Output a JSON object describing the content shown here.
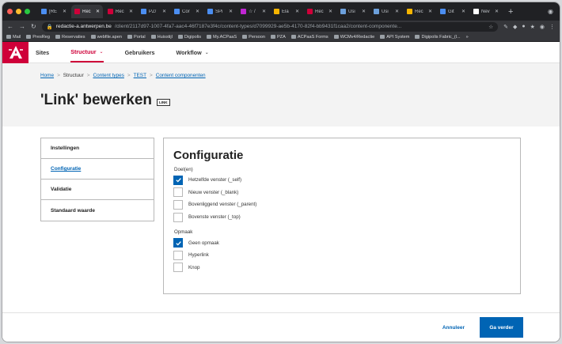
{
  "browser": {
    "tabs": [
      {
        "label": "[RE",
        "color": "#4b8ef1"
      },
      {
        "label": "Rec",
        "color": "#cf0039",
        "active": true
      },
      {
        "label": "Rec",
        "color": "#cf0039"
      },
      {
        "label": "PZ/",
        "color": "#4b8ef1"
      },
      {
        "label": "Cor",
        "color": "#4b8ef1"
      },
      {
        "label": "SPi",
        "color": "#4b8ef1"
      },
      {
        "label": "☆ /",
        "color": "#c026d3"
      },
      {
        "label": "Ela",
        "color": "#f6b500"
      },
      {
        "label": "Rec",
        "color": "#cf0039"
      },
      {
        "label": "Usi",
        "color": "#6ca0dc"
      },
      {
        "label": "Usi",
        "color": "#6ca0dc"
      },
      {
        "label": "Rec",
        "color": "#f6b500"
      },
      {
        "label": "Git",
        "color": "#4b8ef1"
      },
      {
        "label": "Nev",
        "color": "#ffffff"
      }
    ],
    "new_tab": "+",
    "url_host": "redactie-a.antwerpen.be",
    "url_path": "/client/2117d97-1007-4fa7-aac4-46f7187e3f4c/content-types/d7099929-ae5b-4170-82f4-bb9431f1caa2/content-componente...",
    "bookmarks": [
      "Mail",
      "PresReg",
      "Reservaties",
      "webfile.apen",
      "Portal",
      "Huisstijl",
      "Digipolis",
      "My.ACPaaS",
      "Persoon",
      "PZA",
      "ACPaaS Forms",
      "WCMv4/Redactie",
      "API System",
      "Digipolis Fabric_(l..."
    ],
    "bookmarks_more": "»"
  },
  "header": {
    "logo": "A",
    "nav": [
      {
        "label": "Sites",
        "dropdown": false,
        "active": false
      },
      {
        "label": "Structuur",
        "dropdown": true,
        "active": true
      },
      {
        "label": "Gebruikers",
        "dropdown": false,
        "active": false
      },
      {
        "label": "Workflow",
        "dropdown": true,
        "active": false
      }
    ],
    "dropdown_glyph": "⌄"
  },
  "breadcrumb": {
    "items": [
      "Home",
      "Structuur",
      "Content types",
      "TEST",
      "Content componenten"
    ],
    "separator": ">"
  },
  "page": {
    "title": "'Link' bewerken",
    "badge": "LINK"
  },
  "sidemenu": {
    "items": [
      "Instellingen",
      "Configuratie",
      "Validatie",
      "Standaard waarde"
    ]
  },
  "form": {
    "title": "Configuratie",
    "doel_label": "Doel(en)",
    "doel_options": [
      {
        "label": "Hetzelfde venster (_self)",
        "checked": true
      },
      {
        "label": "Nieuw venster (_blank)",
        "checked": false
      },
      {
        "label": "Bovenliggend venster (_parent)",
        "checked": false
      },
      {
        "label": "Bovenste venster (_top)",
        "checked": false
      }
    ],
    "opmaak_label": "Opmaak",
    "opmaak_options": [
      {
        "label": "Geen opmaak",
        "checked": true
      },
      {
        "label": "Hyperlink",
        "checked": false
      },
      {
        "label": "Knop",
        "checked": false
      }
    ]
  },
  "footer": {
    "cancel": "Annuleer",
    "submit": "Ga verder"
  },
  "colors": {
    "brand": "#cf0039",
    "link": "#0064b4"
  }
}
